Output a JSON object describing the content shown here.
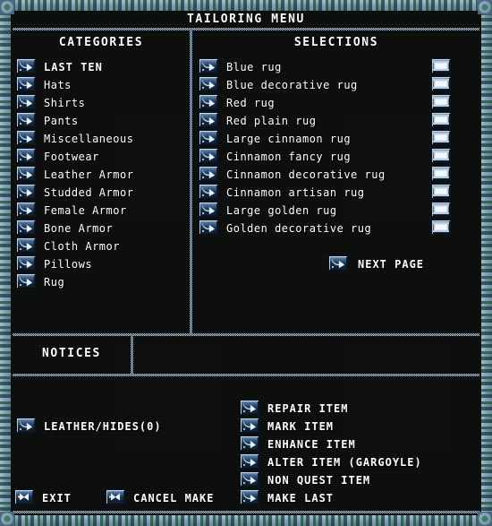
{
  "window": {
    "title": "TAILORING MENU"
  },
  "panels": {
    "categories_header": "CATEGORIES",
    "selections_header": "SELECTIONS",
    "notices_header": "NOTICES",
    "notices_message": ""
  },
  "categories": [
    {
      "label": "LAST TEN",
      "icon": "arrow-right-icon"
    },
    {
      "label": "Hats",
      "icon": "arrow-right-icon"
    },
    {
      "label": "Shirts",
      "icon": "arrow-right-icon"
    },
    {
      "label": "Pants",
      "icon": "arrow-right-icon"
    },
    {
      "label": "Miscellaneous",
      "icon": "arrow-right-icon"
    },
    {
      "label": "Footwear",
      "icon": "arrow-right-icon"
    },
    {
      "label": "Leather Armor",
      "icon": "arrow-right-icon"
    },
    {
      "label": "Studded Armor",
      "icon": "arrow-right-icon"
    },
    {
      "label": "Female Armor",
      "icon": "arrow-right-icon"
    },
    {
      "label": "Bone Armor",
      "icon": "arrow-right-icon"
    },
    {
      "label": "Cloth Armor",
      "icon": "arrow-right-icon"
    },
    {
      "label": "Pillows",
      "icon": "arrow-right-icon"
    },
    {
      "label": "Rug",
      "icon": "arrow-right-icon"
    }
  ],
  "selections": [
    {
      "label": "Blue rug",
      "icon": "arrow-right-icon",
      "preview": "rug-preview-icon"
    },
    {
      "label": "Blue decorative rug",
      "icon": "arrow-right-icon",
      "preview": "rug-preview-icon"
    },
    {
      "label": "Red rug",
      "icon": "arrow-right-icon",
      "preview": "rug-preview-icon"
    },
    {
      "label": "Red plain rug",
      "icon": "arrow-right-icon",
      "preview": "rug-preview-icon"
    },
    {
      "label": "Large cinnamon rug",
      "icon": "arrow-right-icon",
      "preview": "rug-preview-icon"
    },
    {
      "label": "Cinnamon fancy rug",
      "icon": "arrow-right-icon",
      "preview": "rug-preview-icon"
    },
    {
      "label": "Cinnamon decorative rug",
      "icon": "arrow-right-icon",
      "preview": "rug-preview-icon"
    },
    {
      "label": "Cinnamon artisan rug",
      "icon": "arrow-right-icon",
      "preview": "rug-preview-icon"
    },
    {
      "label": "Large golden rug",
      "icon": "arrow-right-icon",
      "preview": "rug-preview-icon"
    },
    {
      "label": "Golden decorative rug",
      "icon": "arrow-right-icon",
      "preview": "rug-preview-icon"
    }
  ],
  "paging": {
    "next_page_label": "NEXT PAGE",
    "next_page_icon": "arrow-right-icon"
  },
  "resources": [
    {
      "label": "LEATHER/HIDES(0)",
      "icon": "arrow-right-icon"
    }
  ],
  "actions": [
    {
      "label": "REPAIR ITEM",
      "icon": "arrow-right-icon"
    },
    {
      "label": "MARK ITEM",
      "icon": "arrow-right-icon"
    },
    {
      "label": "ENHANCE ITEM",
      "icon": "arrow-right-icon"
    },
    {
      "label": "ALTER ITEM (GARGOYLE)",
      "icon": "arrow-right-icon"
    },
    {
      "label": "NON QUEST ITEM",
      "icon": "arrow-right-icon"
    },
    {
      "label": "MAKE LAST",
      "icon": "arrow-right-icon"
    }
  ],
  "footer": {
    "exit_label": "EXIT",
    "exit_icon": "x-close-icon",
    "cancel_make_label": "CANCEL MAKE",
    "cancel_make_icon": "x-close-icon"
  },
  "colors": {
    "background": "#070a08",
    "frame": "#7e9ab4",
    "frame_accent": "#2c5c46",
    "text": "#ffffff",
    "separator": "#b9cde0",
    "button_highlight": "#cde2f4",
    "button_shadow": "#0d1b2c"
  }
}
